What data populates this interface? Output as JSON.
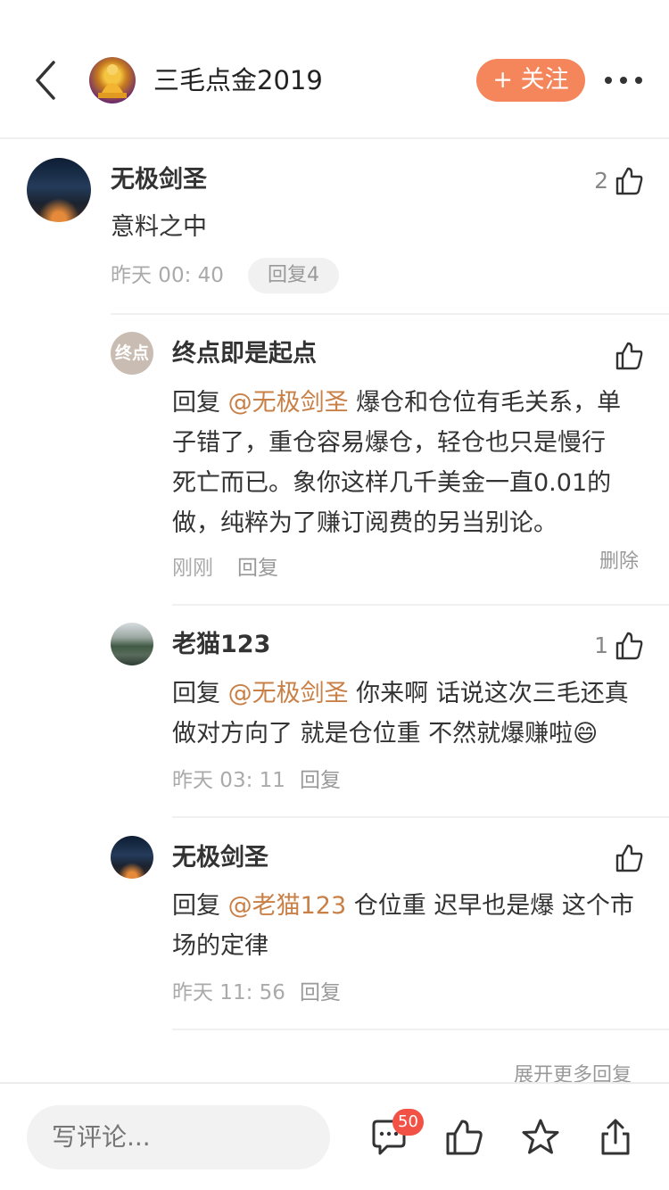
{
  "header": {
    "title": "三毛点金2019",
    "follow_label": "+ 关注"
  },
  "comments": [
    {
      "user": "无极剑圣",
      "text": "意料之中",
      "time": "昨天 00: 40",
      "reply_count_label": "回复4",
      "likes": "2"
    }
  ],
  "replies": [
    {
      "avatar_text": "终点",
      "user": "终点即是起点",
      "prefix": "回复 ",
      "mention": "@无极剑圣",
      "line1_rest": " 爆仓和仓位有毛关系，单",
      "line2": "子错了，重仓容易爆仓，轻仓也只是慢行",
      "line3": "死亡而已。象你这样几千美金一直0.01的",
      "line4": "做，纯粹为了赚订阅费的另当别论。",
      "time": "刚刚",
      "reply_label": "回复",
      "delete_label": "删除",
      "likes": ""
    },
    {
      "user": "老猫123",
      "prefix": "回复 ",
      "mention": "@无极剑圣",
      "line1_rest": " 你来啊 话说这次三毛还真",
      "line2": "做对方向了 就是仓位重 不然就爆赚啦",
      "emoji": "😄",
      "time": "昨天 03: 11",
      "reply_label": "回复",
      "likes": "1"
    },
    {
      "user": "无极剑圣",
      "prefix": "回复 ",
      "mention": "@老猫123",
      "line1_rest": " 仓位重 迟早也是爆 这个市",
      "line2": "场的定律",
      "time": "昨天 11: 56",
      "reply_label": "回复",
      "likes": ""
    }
  ],
  "expand_more_label": "展开更多回复",
  "bottom_bar": {
    "input_placeholder": "写评论...",
    "comment_badge": "50"
  },
  "colors": {
    "accent": "#f5855a",
    "mention": "#c98047",
    "badge": "#f25246"
  }
}
